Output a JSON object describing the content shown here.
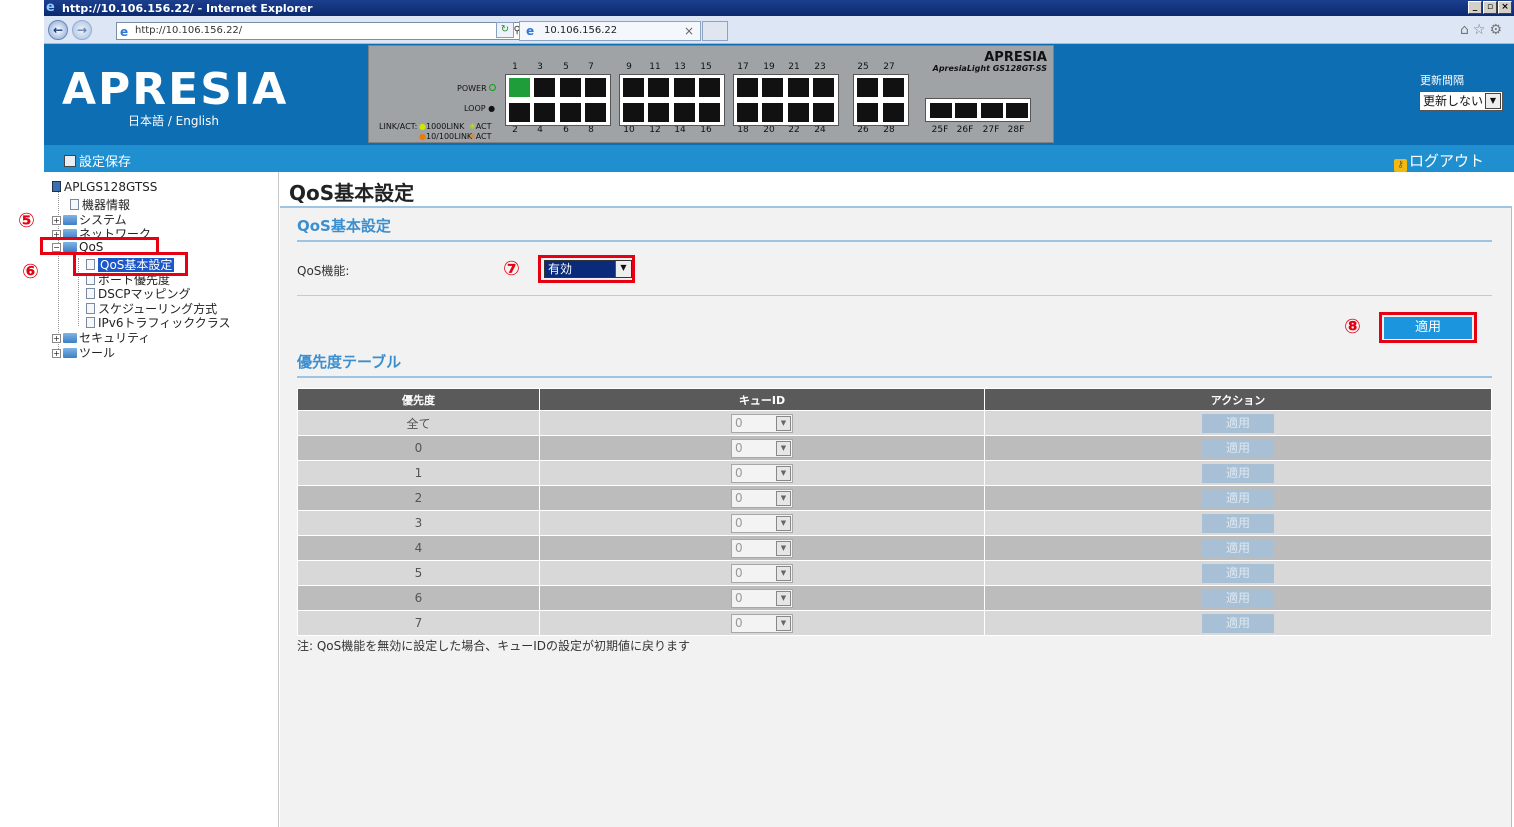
{
  "browser": {
    "window_title": "http://10.106.156.22/ - Internet Explorer",
    "address": "http://10.106.156.22/",
    "tab_title": "10.106.156.22"
  },
  "header": {
    "brand": "APRESIA",
    "language": "日本語 / English",
    "model_brand": "APRESIA",
    "model_name": "ApresiaLight GS128GT-SS",
    "power_label": "POWER",
    "loop_label": "LOOP",
    "legend_link": "LINK/ACT:",
    "legend_1000": "1000LINK",
    "legend_100": "10/100LINK",
    "legend_act": "ACT",
    "top_ports": [
      "1",
      "3",
      "5",
      "7",
      "9",
      "11",
      "13",
      "15",
      "17",
      "19",
      "21",
      "23",
      "25",
      "27"
    ],
    "bottom_ports": [
      "2",
      "4",
      "6",
      "8",
      "10",
      "12",
      "14",
      "16",
      "18",
      "20",
      "22",
      "24",
      "26",
      "28"
    ],
    "sfp_ports": [
      "25F",
      "26F",
      "27F",
      "28F"
    ],
    "refresh_label": "更新間隔",
    "refresh_value": "更新しない"
  },
  "toolbar": {
    "save_label": "設定保存",
    "logout_label": "ログアウト"
  },
  "sidebar": {
    "root": "APLGS128GTSS",
    "items": {
      "device_info": "機器情報",
      "system": "システム",
      "network": "ネットワーク",
      "qos": "QoS",
      "qos_basic": "QoS基本設定",
      "port_priority": "ポート優先度",
      "dscp": "DSCPマッピング",
      "scheduling": "スケジューリング方式",
      "ipv6": "IPv6トラフィッククラス",
      "security": "セキュリティ",
      "tools": "ツール"
    }
  },
  "annotations": {
    "step5": "⑤",
    "step6": "⑥",
    "step7": "⑦",
    "step8": "⑧"
  },
  "main": {
    "page_title": "QoS基本設定",
    "section1_title": "QoS基本設定",
    "qos_function_label": "QoS機能:",
    "qos_function_value": "有効",
    "apply_label": "適用",
    "section2_title": "優先度テーブル",
    "table": {
      "headers": [
        "優先度",
        "キューID",
        "アクション"
      ],
      "rows": [
        {
          "priority": "全て",
          "queue": "0",
          "action": "適用"
        },
        {
          "priority": "0",
          "queue": "0",
          "action": "適用"
        },
        {
          "priority": "1",
          "queue": "0",
          "action": "適用"
        },
        {
          "priority": "2",
          "queue": "0",
          "action": "適用"
        },
        {
          "priority": "3",
          "queue": "0",
          "action": "適用"
        },
        {
          "priority": "4",
          "queue": "0",
          "action": "適用"
        },
        {
          "priority": "5",
          "queue": "0",
          "action": "適用"
        },
        {
          "priority": "6",
          "queue": "0",
          "action": "適用"
        },
        {
          "priority": "7",
          "queue": "0",
          "action": "適用"
        }
      ]
    },
    "note": "注: QoS機能を無効に設定した場合、キューIDの設定が初期値に戻ります"
  }
}
